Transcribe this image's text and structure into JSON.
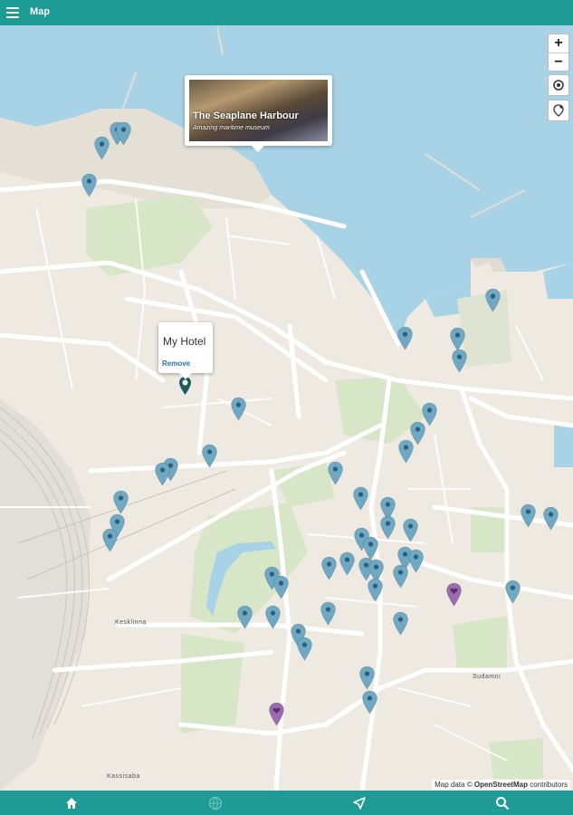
{
  "app": {
    "title": "Map"
  },
  "zoom": {
    "in": "+",
    "out": "−"
  },
  "popups": {
    "harbour": {
      "title": "The Seaplane Harbour",
      "subtitle": "Amazing maritime museum"
    },
    "hotel": {
      "name": "My Hotel",
      "action": "Remove"
    }
  },
  "map_labels": [
    "Kesklinna",
    "Kassisaba",
    "Sudamni",
    "Kesklin"
  ],
  "attribution": {
    "prefix": "Map data ©",
    "link": "OpenStreetMap",
    "suffix": "contributors"
  },
  "nav": [
    "home-icon",
    "globe-icon",
    "navigate-icon",
    "search-icon"
  ],
  "colors": {
    "bar": "#1f9b95",
    "pin": "#6fa8c2",
    "heart_pin": "#9b6bb2",
    "hotel_pin": "#1d5b5e",
    "water": "#a8d3e6",
    "park": "#d6e6c7"
  }
}
